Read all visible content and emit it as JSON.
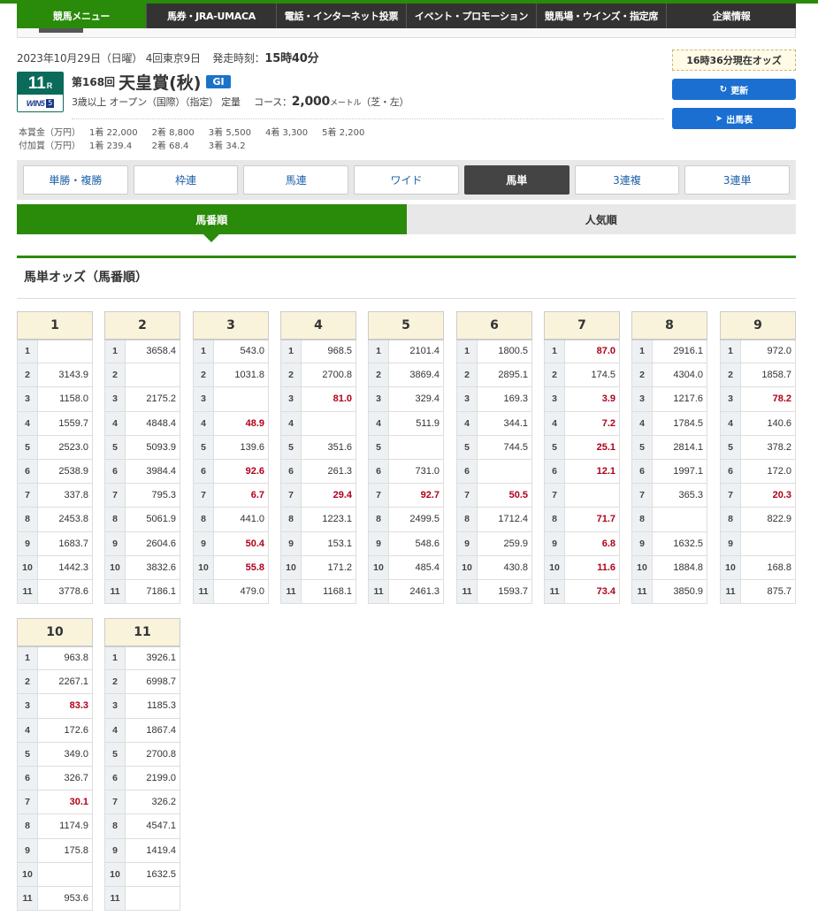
{
  "nav": {
    "items": [
      "競馬メニュー",
      "馬券・JRA-UMACA",
      "電話・インターネット投票",
      "イベント・プロモーション",
      "競馬場・ウインズ・指定席",
      "企業情報"
    ],
    "active_index": 0
  },
  "race": {
    "date_line": "2023年10月29日（日曜）  4回東京9日",
    "start_label": "発走時刻：",
    "start_time": "15時40分",
    "race_number": "11",
    "race_suffix": "R",
    "wins_logo": "WIN5",
    "wins_num": "5",
    "kai": "第168回",
    "name": "天皇賞(秋)",
    "grade": "GI",
    "conditions": "3歳以上  オープン（国際）（指定）  定量",
    "course_label": "コース：",
    "course_distance": "2,000",
    "course_unit": "メートル",
    "course_surface": "（芝・左）"
  },
  "prize": {
    "rows": [
      {
        "label": "本賞金（万円）",
        "items": [
          "1着",
          "22,000",
          "2着",
          "8,800",
          "3着",
          "5,500",
          "4着",
          "3,300",
          "5着",
          "2,200"
        ]
      },
      {
        "label": "付加賞（万円）",
        "items": [
          "1着",
          "239.4",
          "2着",
          "68.4",
          "3着",
          "34.2"
        ]
      }
    ]
  },
  "odds_time": "16時36分現在オッズ",
  "buttons": {
    "refresh": "更新",
    "entries": "出馬表"
  },
  "bet_tabs": [
    "単勝・複勝",
    "枠連",
    "馬連",
    "ワイド",
    "馬単",
    "3連複",
    "3連単"
  ],
  "bet_tab_active": 4,
  "sort_tabs": [
    "馬番順",
    "人気順"
  ],
  "sort_tab_active": 0,
  "section_title": "馬単オッズ（馬番順）",
  "colors": {
    "green": "#2a8a0a",
    "fav_red": "#b0001a",
    "header_bg": "#f9f3db"
  },
  "odds_tables": [
    {
      "first": "1",
      "rows": [
        [
          "1",
          ""
        ],
        [
          "2",
          "3143.9"
        ],
        [
          "3",
          "1158.0"
        ],
        [
          "4",
          "1559.7"
        ],
        [
          "5",
          "2523.0"
        ],
        [
          "6",
          "2538.9"
        ],
        [
          "7",
          "337.8"
        ],
        [
          "8",
          "2453.8"
        ],
        [
          "9",
          "1683.7"
        ],
        [
          "10",
          "1442.3"
        ],
        [
          "11",
          "3778.6"
        ]
      ]
    },
    {
      "first": "2",
      "rows": [
        [
          "1",
          "3658.4"
        ],
        [
          "2",
          ""
        ],
        [
          "3",
          "2175.2"
        ],
        [
          "4",
          "4848.4"
        ],
        [
          "5",
          "5093.9"
        ],
        [
          "6",
          "3984.4"
        ],
        [
          "7",
          "795.3"
        ],
        [
          "8",
          "5061.9"
        ],
        [
          "9",
          "2604.6"
        ],
        [
          "10",
          "3832.6"
        ],
        [
          "11",
          "7186.1"
        ]
      ]
    },
    {
      "first": "3",
      "rows": [
        [
          "1",
          "543.0"
        ],
        [
          "2",
          "1031.8"
        ],
        [
          "3",
          ""
        ],
        [
          "4",
          "48.9"
        ],
        [
          "5",
          "139.6"
        ],
        [
          "6",
          "92.6"
        ],
        [
          "7",
          "6.7"
        ],
        [
          "8",
          "441.0"
        ],
        [
          "9",
          "50.4"
        ],
        [
          "10",
          "55.8"
        ],
        [
          "11",
          "479.0"
        ]
      ]
    },
    {
      "first": "4",
      "rows": [
        [
          "1",
          "968.5"
        ],
        [
          "2",
          "2700.8"
        ],
        [
          "3",
          "81.0"
        ],
        [
          "4",
          ""
        ],
        [
          "5",
          "351.6"
        ],
        [
          "6",
          "261.3"
        ],
        [
          "7",
          "29.4"
        ],
        [
          "8",
          "1223.1"
        ],
        [
          "9",
          "153.1"
        ],
        [
          "10",
          "171.2"
        ],
        [
          "11",
          "1168.1"
        ]
      ]
    },
    {
      "first": "5",
      "rows": [
        [
          "1",
          "2101.4"
        ],
        [
          "2",
          "3869.4"
        ],
        [
          "3",
          "329.4"
        ],
        [
          "4",
          "511.9"
        ],
        [
          "5",
          ""
        ],
        [
          "6",
          "731.0"
        ],
        [
          "7",
          "92.7"
        ],
        [
          "8",
          "2499.5"
        ],
        [
          "9",
          "548.6"
        ],
        [
          "10",
          "485.4"
        ],
        [
          "11",
          "2461.3"
        ]
      ]
    },
    {
      "first": "6",
      "rows": [
        [
          "1",
          "1800.5"
        ],
        [
          "2",
          "2895.1"
        ],
        [
          "3",
          "169.3"
        ],
        [
          "4",
          "344.1"
        ],
        [
          "5",
          "744.5"
        ],
        [
          "6",
          ""
        ],
        [
          "7",
          "50.5"
        ],
        [
          "8",
          "1712.4"
        ],
        [
          "9",
          "259.9"
        ],
        [
          "10",
          "430.8"
        ],
        [
          "11",
          "1593.7"
        ]
      ]
    },
    {
      "first": "7",
      "rows": [
        [
          "1",
          "87.0"
        ],
        [
          "2",
          "174.5"
        ],
        [
          "3",
          "3.9"
        ],
        [
          "4",
          "7.2"
        ],
        [
          "5",
          "25.1"
        ],
        [
          "6",
          "12.1"
        ],
        [
          "7",
          ""
        ],
        [
          "8",
          "71.7"
        ],
        [
          "9",
          "6.8"
        ],
        [
          "10",
          "11.6"
        ],
        [
          "11",
          "73.4"
        ]
      ]
    },
    {
      "first": "8",
      "rows": [
        [
          "1",
          "2916.1"
        ],
        [
          "2",
          "4304.0"
        ],
        [
          "3",
          "1217.6"
        ],
        [
          "4",
          "1784.5"
        ],
        [
          "5",
          "2814.1"
        ],
        [
          "6",
          "1997.1"
        ],
        [
          "7",
          "365.3"
        ],
        [
          "8",
          ""
        ],
        [
          "9",
          "1632.5"
        ],
        [
          "10",
          "1884.8"
        ],
        [
          "11",
          "3850.9"
        ]
      ]
    },
    {
      "first": "9",
      "rows": [
        [
          "1",
          "972.0"
        ],
        [
          "2",
          "1858.7"
        ],
        [
          "3",
          "78.2"
        ],
        [
          "4",
          "140.6"
        ],
        [
          "5",
          "378.2"
        ],
        [
          "6",
          "172.0"
        ],
        [
          "7",
          "20.3"
        ],
        [
          "8",
          "822.9"
        ],
        [
          "9",
          ""
        ],
        [
          "10",
          "168.8"
        ],
        [
          "11",
          "875.7"
        ]
      ]
    },
    {
      "first": "10",
      "rows": [
        [
          "1",
          "963.8"
        ],
        [
          "2",
          "2267.1"
        ],
        [
          "3",
          "83.3"
        ],
        [
          "4",
          "172.6"
        ],
        [
          "5",
          "349.0"
        ],
        [
          "6",
          "326.7"
        ],
        [
          "7",
          "30.1"
        ],
        [
          "8",
          "1174.9"
        ],
        [
          "9",
          "175.8"
        ],
        [
          "10",
          ""
        ],
        [
          "11",
          "953.6"
        ]
      ]
    },
    {
      "first": "11",
      "rows": [
        [
          "1",
          "3926.1"
        ],
        [
          "2",
          "6998.7"
        ],
        [
          "3",
          "1185.3"
        ],
        [
          "4",
          "1867.4"
        ],
        [
          "5",
          "2700.8"
        ],
        [
          "6",
          "2199.0"
        ],
        [
          "7",
          "326.2"
        ],
        [
          "8",
          "4547.1"
        ],
        [
          "9",
          "1419.4"
        ],
        [
          "10",
          "1632.5"
        ],
        [
          "11",
          ""
        ]
      ]
    }
  ]
}
